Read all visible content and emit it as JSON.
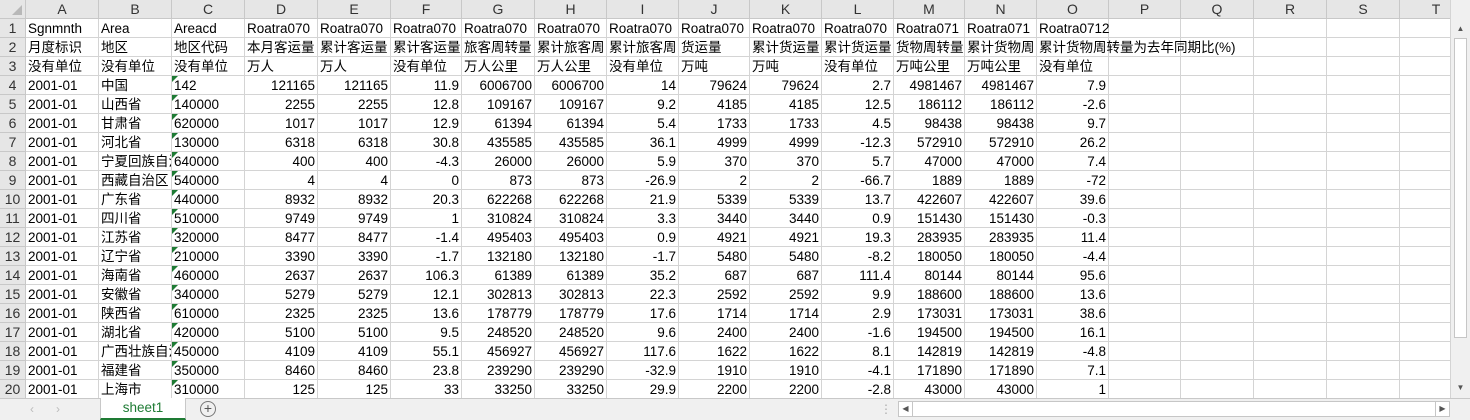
{
  "columns": [
    "A",
    "B",
    "C",
    "D",
    "E",
    "F",
    "G",
    "H",
    "I",
    "J",
    "K",
    "L",
    "M",
    "N",
    "O",
    "P",
    "Q",
    "R",
    "S",
    "T"
  ],
  "rows": [
    [
      "Sgnmnth",
      "Area",
      "Areacd",
      "Roatra070",
      "Roatra070",
      "Roatra070",
      "Roatra070",
      "Roatra070",
      "Roatra070",
      "Roatra070",
      "Roatra070",
      "Roatra070",
      "Roatra071",
      "Roatra071",
      "Roatra0712"
    ],
    [
      "月度标识",
      "地区",
      "地区代码",
      "本月客运量",
      "累计客运量",
      "累计客运量",
      "旅客周转量",
      "累计旅客周",
      "累计旅客周",
      "货运量",
      "累计货运量",
      "累计货运量",
      "货物周转量",
      "累计货物周",
      "累计货物周转量为去年同期比(%)"
    ],
    [
      "没有单位",
      "没有单位",
      "没有单位",
      "万人",
      "万人",
      "没有单位",
      "万人公里",
      "万人公里",
      "没有单位",
      "万吨",
      "万吨",
      "没有单位",
      "万吨公里",
      "万吨公里",
      "没有单位"
    ],
    [
      "2001-01",
      "中国",
      "142",
      "121165",
      "121165",
      "11.9",
      "6006700",
      "6006700",
      "14",
      "79624",
      "79624",
      "2.7",
      "4981467",
      "4981467",
      "7.9"
    ],
    [
      "2001-01",
      "山西省",
      "140000",
      "2255",
      "2255",
      "12.8",
      "109167",
      "109167",
      "9.2",
      "4185",
      "4185",
      "12.5",
      "186112",
      "186112",
      "-2.6"
    ],
    [
      "2001-01",
      "甘肃省",
      "620000",
      "1017",
      "1017",
      "12.9",
      "61394",
      "61394",
      "5.4",
      "1733",
      "1733",
      "4.5",
      "98438",
      "98438",
      "9.7"
    ],
    [
      "2001-01",
      "河北省",
      "130000",
      "6318",
      "6318",
      "30.8",
      "435585",
      "435585",
      "36.1",
      "4999",
      "4999",
      "-12.3",
      "572910",
      "572910",
      "26.2"
    ],
    [
      "2001-01",
      "宁夏回族自治区",
      "640000",
      "400",
      "400",
      "-4.3",
      "26000",
      "26000",
      "5.9",
      "370",
      "370",
      "5.7",
      "47000",
      "47000",
      "7.4"
    ],
    [
      "2001-01",
      "西藏自治区",
      "540000",
      "4",
      "4",
      "0",
      "873",
      "873",
      "-26.9",
      "2",
      "2",
      "-66.7",
      "1889",
      "1889",
      "-72"
    ],
    [
      "2001-01",
      "广东省",
      "440000",
      "8932",
      "8932",
      "20.3",
      "622268",
      "622268",
      "21.9",
      "5339",
      "5339",
      "13.7",
      "422607",
      "422607",
      "39.6"
    ],
    [
      "2001-01",
      "四川省",
      "510000",
      "9749",
      "9749",
      "1",
      "310824",
      "310824",
      "3.3",
      "3440",
      "3440",
      "0.9",
      "151430",
      "151430",
      "-0.3"
    ],
    [
      "2001-01",
      "江苏省",
      "320000",
      "8477",
      "8477",
      "-1.4",
      "495403",
      "495403",
      "0.9",
      "4921",
      "4921",
      "19.3",
      "283935",
      "283935",
      "11.4"
    ],
    [
      "2001-01",
      "辽宁省",
      "210000",
      "3390",
      "3390",
      "-1.7",
      "132180",
      "132180",
      "-1.7",
      "5480",
      "5480",
      "-8.2",
      "180050",
      "180050",
      "-4.4"
    ],
    [
      "2001-01",
      "海南省",
      "460000",
      "2637",
      "2637",
      "106.3",
      "61389",
      "61389",
      "35.2",
      "687",
      "687",
      "111.4",
      "80144",
      "80144",
      "95.6"
    ],
    [
      "2001-01",
      "安徽省",
      "340000",
      "5279",
      "5279",
      "12.1",
      "302813",
      "302813",
      "22.3",
      "2592",
      "2592",
      "9.9",
      "188600",
      "188600",
      "13.6"
    ],
    [
      "2001-01",
      "陕西省",
      "610000",
      "2325",
      "2325",
      "13.6",
      "178779",
      "178779",
      "17.6",
      "1714",
      "1714",
      "2.9",
      "173031",
      "173031",
      "38.6"
    ],
    [
      "2001-01",
      "湖北省",
      "420000",
      "5100",
      "5100",
      "9.5",
      "248520",
      "248520",
      "9.6",
      "2400",
      "2400",
      "-1.6",
      "194500",
      "194500",
      "16.1"
    ],
    [
      "2001-01",
      "广西壮族自治区",
      "450000",
      "4109",
      "4109",
      "55.1",
      "456927",
      "456927",
      "117.6",
      "1622",
      "1622",
      "8.1",
      "142819",
      "142819",
      "-4.8"
    ],
    [
      "2001-01",
      "福建省",
      "350000",
      "8460",
      "8460",
      "23.8",
      "239290",
      "239290",
      "-32.9",
      "1910",
      "1910",
      "-4.1",
      "171890",
      "171890",
      "7.1"
    ],
    [
      "2001-01",
      "上海市",
      "310000",
      "125",
      "125",
      "33",
      "33250",
      "33250",
      "29.9",
      "2200",
      "2200",
      "-2.8",
      "43000",
      "43000",
      "1"
    ]
  ],
  "sheet_tabs": [
    {
      "label": "sheet1",
      "active": true
    }
  ],
  "add_sheet_icon": "+",
  "colors": {
    "accent": "#1e7b34",
    "header_bg": "#e6e6e6",
    "gridline": "#d4d4d4"
  }
}
